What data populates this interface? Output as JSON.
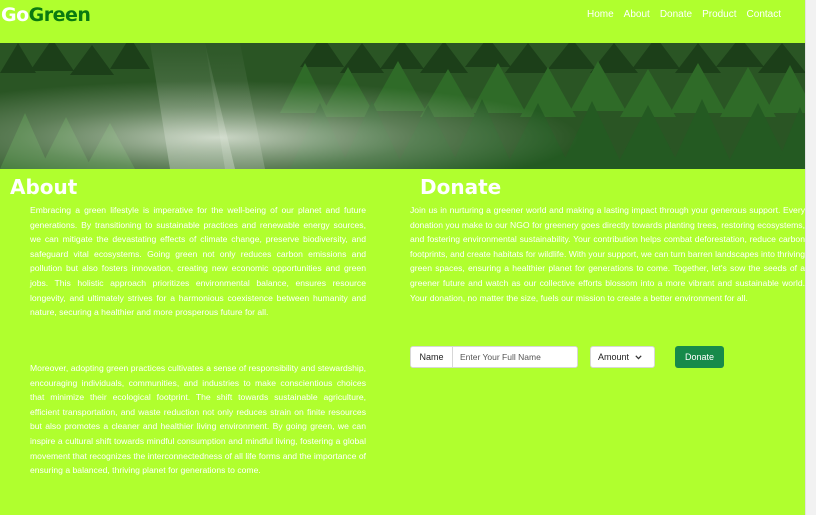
{
  "brand": {
    "part1": "Go",
    "part2": "Green"
  },
  "nav": {
    "items": [
      "Home",
      "About",
      "Donate",
      "Product",
      "Contact"
    ]
  },
  "about": {
    "title": "About",
    "paragraphs": [
      "Embracing a green lifestyle is imperative for the well-being of our planet and future generations. By transitioning to sustainable practices and renewable energy sources, we can mitigate the devastating effects of climate change, preserve biodiversity, and safeguard vital ecosystems. Going green not only reduces carbon emissions and pollution but also fosters innovation, creating new economic opportunities and green jobs. This holistic approach prioritizes environmental balance, ensures resource longevity, and ultimately strives for a harmonious coexistence between humanity and nature, securing a healthier and more prosperous future for all.",
      "Moreover, adopting green practices cultivates a sense of responsibility and stewardship, encouraging individuals, communities, and industries to make conscientious choices that minimize their ecological footprint. The shift towards sustainable agriculture, efficient transportation, and waste reduction not only reduces strain on finite resources but also promotes a cleaner and healthier living environment. By going green, we can inspire a cultural shift towards mindful consumption and mindful living, fostering a global movement that recognizes the interconnectedness of all life forms and the importance of ensuring a balanced, thriving planet for generations to come."
    ]
  },
  "donate": {
    "title": "Donate",
    "paragraph": "Join us in nurturing a greener world and making a lasting impact through your generous support. Every donation you make to our NGO for greenery goes directly towards planting trees, restoring ecosystems, and fostering environmental sustainability. Your contribution helps combat deforestation, reduce carbon footprints, and create habitats for wildlife. With your support, we can turn barren landscapes into thriving green spaces, ensuring a healthier planet for generations to come. Together, let's sow the seeds of a greener future and watch as our collective efforts blossom into a more vibrant and sustainable world. Your donation, no matter the size, fuels our mission to create a better environment for all.",
    "name_label": "Name",
    "name_placeholder": "Enter Your Full Name",
    "amount_label": "Amount",
    "button_label": "Donate"
  },
  "icons": {
    "amount_chevron": "chevron-down-icon"
  },
  "colors": {
    "page_bg": "#b0ff2e",
    "logo_green": "#0a7a10",
    "button_bg": "#178a4a",
    "text": "#ffffff"
  }
}
